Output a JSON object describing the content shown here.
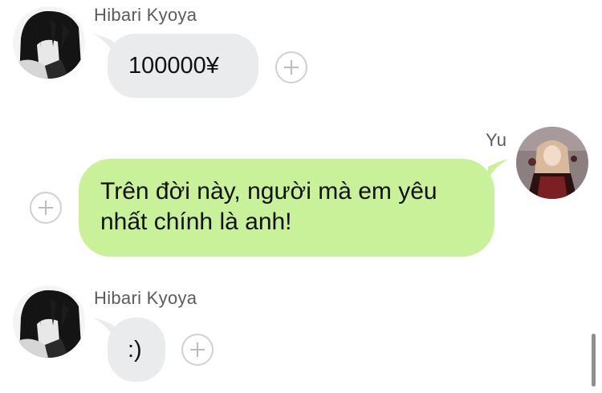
{
  "messages": [
    {
      "sender": "Hibari Kyoya",
      "text": "100000¥",
      "side": "left"
    },
    {
      "sender": "Yu",
      "text": "Trên đời này, người mà em yêu nhất chính là anh!",
      "side": "right"
    },
    {
      "sender": "Hibari Kyoya",
      "text": ":)",
      "side": "left"
    }
  ],
  "icons": {
    "add": "plus-circle-icon",
    "avatar_hibari": "hibari-avatar",
    "avatar_yu": "yu-avatar"
  },
  "colors": {
    "incoming_bubble": "#e9ebed",
    "outgoing_bubble": "#c8f19a",
    "name_text": "#5b5b5b",
    "add_border": "#d0d0d0"
  }
}
